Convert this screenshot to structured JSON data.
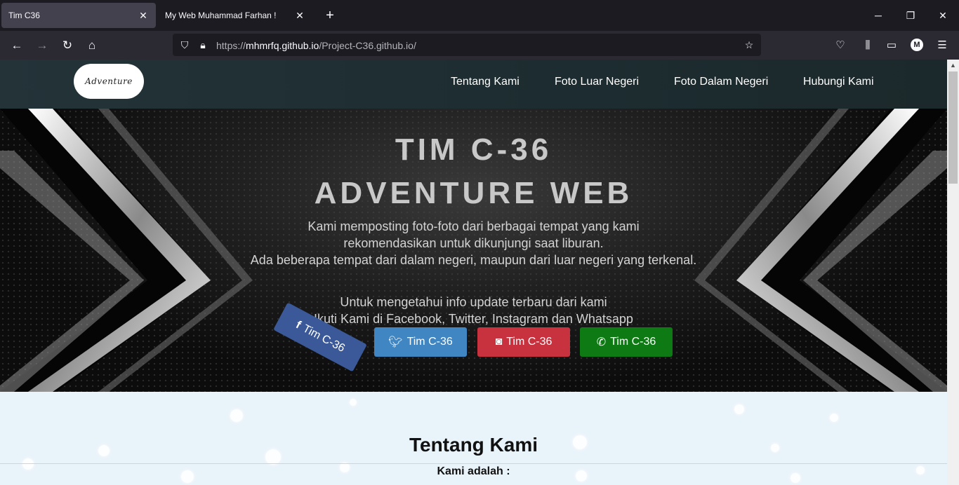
{
  "browser": {
    "tabs": [
      {
        "title": "Tim C36",
        "active": true
      },
      {
        "title": "My Web Muhammad Farhan !",
        "active": false
      }
    ],
    "new_tab": "+",
    "url_host": "mhmrfq.github.io",
    "url_prefix": "https://",
    "url_path": "/Project-C36.github.io/",
    "profile_initial": "M"
  },
  "site": {
    "logo_text": "Adventure",
    "menu": [
      "Tentang Kami",
      "Foto Luar Negeri",
      "Foto Dalam Negeri",
      "Hubungi Kami"
    ],
    "hero": {
      "title_line1": "TIM C-36",
      "title_line2": "ADVENTURE WEB",
      "desc_line1": "Kami memposting foto-foto dari berbagai tempat yang kami",
      "desc_line2": "rekomendasikan untuk dikunjungi saat liburan.",
      "desc_line3": "Ada beberapa tempat dari dalam negeri, maupun dari luar negeri yang terkenal.",
      "info_line1": "Untuk mengetahui info update terbaru dari kami",
      "info_line2": "Ikuti Kami di Facebook, Twitter, Instagram dan Whatsapp",
      "buttons": [
        {
          "label": "Tim C-36",
          "icon": "facebook-icon",
          "color": "#3b5998"
        },
        {
          "label": "Tim C-36",
          "icon": "twitter-icon",
          "color": "#3f86c2"
        },
        {
          "label": "Tim C-36",
          "icon": "instagram-icon",
          "color": "#c8323f"
        },
        {
          "label": "Tim C-36",
          "icon": "whatsapp-icon",
          "color": "#0d7a13"
        }
      ]
    },
    "about": {
      "title": "Tentang Kami",
      "subtitle": "Kami adalah :"
    }
  }
}
